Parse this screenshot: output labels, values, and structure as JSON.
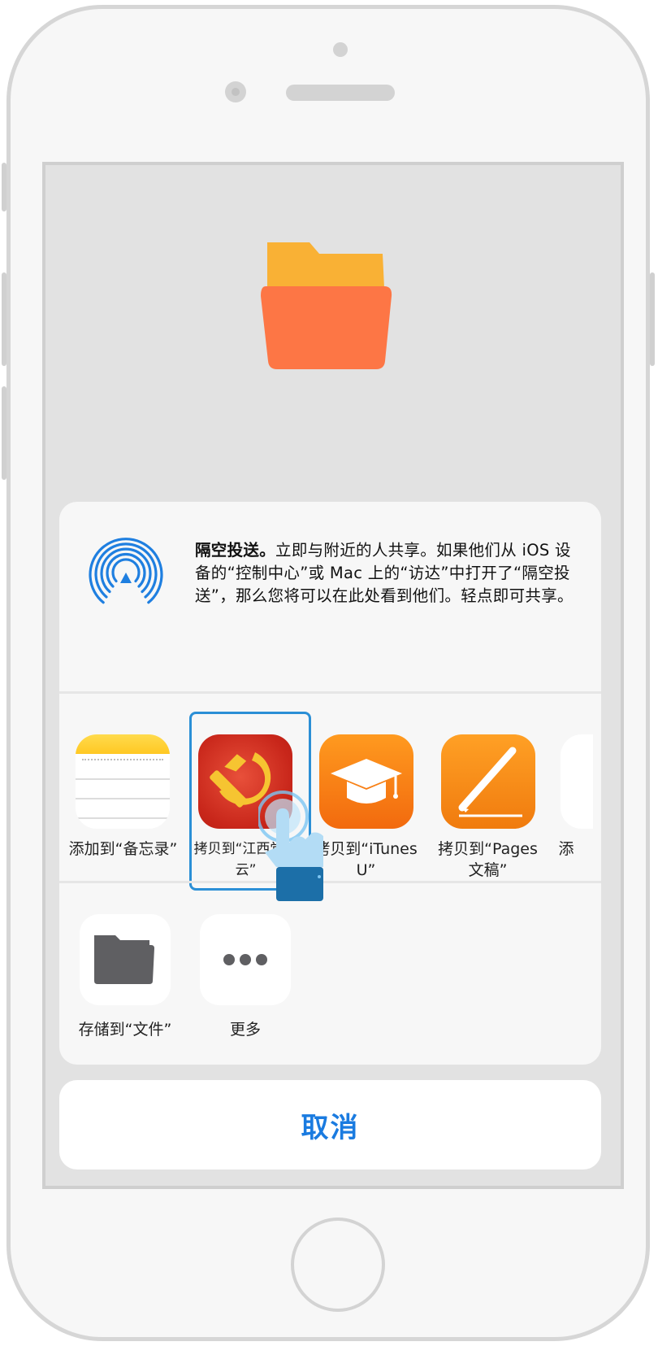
{
  "airdrop": {
    "title": "隔空投送。",
    "body": "立即与附近的人共享。如果他们从 iOS 设备的“控制中心”或 Mac 上的“访达”中打开了“隔空投送”，那么您将可以在此处看到他们。轻点即可共享。"
  },
  "apps": [
    {
      "label": "添加到“备忘录”",
      "icon": "notes-app-icon"
    },
    {
      "label": "拷贝到“江西党建云”",
      "icon": "party-app-icon"
    },
    {
      "label": "拷贝到“iTunes U”",
      "icon": "itunes-u-app-icon"
    },
    {
      "label": "拷贝到“Pages文稿”",
      "icon": "pages-app-icon"
    },
    {
      "label": "添",
      "icon": "partial-app-icon"
    }
  ],
  "actions": [
    {
      "label": "存储到“文件”",
      "icon": "folder-icon"
    },
    {
      "label": "更多",
      "icon": "more-icon"
    }
  ],
  "cancel_label": "取消",
  "colors": {
    "accent": "#1a7be0",
    "airdrop_blue": "#1f7fe0",
    "folder_back": "#f9b135",
    "folder_front": "#fd7645",
    "highlight_border": "#2b8fd6"
  }
}
